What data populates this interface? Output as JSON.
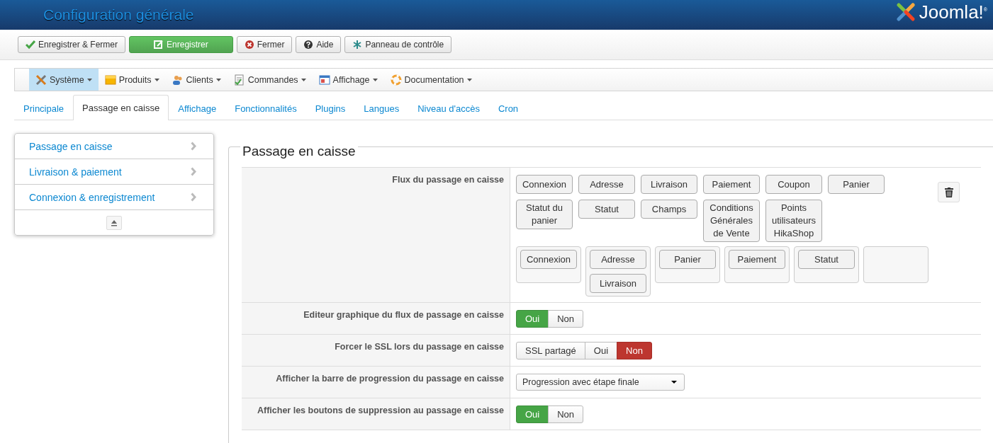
{
  "header": {
    "title": "Configuration générale",
    "logo": "Joomla!$^{®}$"
  },
  "toolbar": [
    {
      "label": "Enregistrer & Fermer",
      "kind": "default"
    },
    {
      "label": "Enregistrer",
      "kind": "success"
    },
    {
      "label": "Fermer",
      "kind": "default"
    },
    {
      "label": "Aide",
      "kind": "default"
    },
    {
      "label": "Panneau de contrôle",
      "kind": "default"
    }
  ],
  "menu": [
    {
      "label": "Système",
      "selected": true
    },
    {
      "label": "Produits",
      "selected": false
    },
    {
      "label": "Clients",
      "selected": false
    },
    {
      "label": "Commandes",
      "selected": false
    },
    {
      "label": "Affichage",
      "selected": false
    },
    {
      "label": "Documentation",
      "selected": false
    }
  ],
  "tabs": [
    {
      "label": "Principale",
      "selected": false
    },
    {
      "label": "Passage en caisse",
      "selected": true
    },
    {
      "label": "Affichage",
      "selected": false
    },
    {
      "label": "Fonctionnalités",
      "selected": false
    },
    {
      "label": "Plugins",
      "selected": false
    },
    {
      "label": "Langues",
      "selected": false
    },
    {
      "label": "Niveau d'accès",
      "selected": false
    },
    {
      "label": "Cron",
      "selected": false
    }
  ],
  "sidebar": {
    "items": [
      {
        "label": "Passage en caisse"
      },
      {
        "label": "Livraison & paiement"
      },
      {
        "label": "Connexion & enregistrement"
      }
    ]
  },
  "section": {
    "legend": "Passage en caisse",
    "fields": [
      {
        "kind": "flow",
        "label": "Flux du passage en caisse",
        "available": [
          "Connexion",
          "Adresse",
          "Livraison",
          "Paiement",
          "Coupon",
          "Panier",
          "Statut du panier",
          "Statut",
          "Champs",
          "Conditions Générales de Vente",
          "Points utilisateurs HikaShop"
        ],
        "steps": [
          {
            "items": [
              "Connexion"
            ]
          },
          {
            "items": [
              "Adresse",
              "Livraison"
            ]
          },
          {
            "items": [
              "Panier"
            ]
          },
          {
            "items": [
              "Paiement"
            ]
          },
          {
            "items": [
              "Statut"
            ]
          }
        ]
      },
      {
        "kind": "toggle",
        "label": "Editeur graphique du flux de passage en caisse",
        "options": [
          {
            "label": "Oui",
            "selected": true
          },
          {
            "label": "Non",
            "selected": false
          }
        ]
      },
      {
        "kind": "toggle",
        "label": "Forcer le SSL lors du passage en caisse",
        "options": [
          {
            "label": "SSL partagé",
            "selected": false
          },
          {
            "label": "Oui",
            "selected": false
          },
          {
            "label": "Non",
            "selected": true
          }
        ]
      },
      {
        "kind": "select",
        "label": "Afficher la barre de progression du passage en caisse",
        "value": "Progression avec étape finale"
      },
      {
        "kind": "toggle",
        "label": "Afficher les boutons de suppression au passage en caisse",
        "options": [
          {
            "label": "Oui",
            "selected": true
          },
          {
            "label": "Non",
            "selected": false
          }
        ]
      }
    ]
  }
}
